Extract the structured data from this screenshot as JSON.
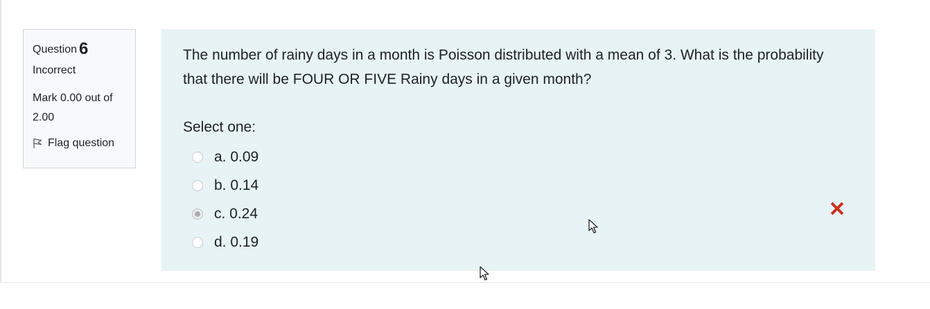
{
  "question_info": {
    "label": "Question",
    "number": "6",
    "state": "Incorrect",
    "grade": "Mark 0.00 out of 2.00",
    "flag_label": "Flag question"
  },
  "question": {
    "text": "The number of rainy days in a month is Poisson distributed with a mean of 3. What is the probability that there will be FOUR OR FIVE Rainy days in a given month?",
    "prompt": "Select one:",
    "options": [
      {
        "label": "a. 0.09",
        "selected": false
      },
      {
        "label": "b. 0.14",
        "selected": false
      },
      {
        "label": "c. 0.24",
        "selected": true
      },
      {
        "label": "d. 0.19",
        "selected": false
      }
    ],
    "feedback_icon": "incorrect-cross-icon"
  },
  "colors": {
    "formulation_bg": "#e7f3f5",
    "info_bg": "#f8f9fa",
    "incorrect_red": "#ca3120"
  }
}
